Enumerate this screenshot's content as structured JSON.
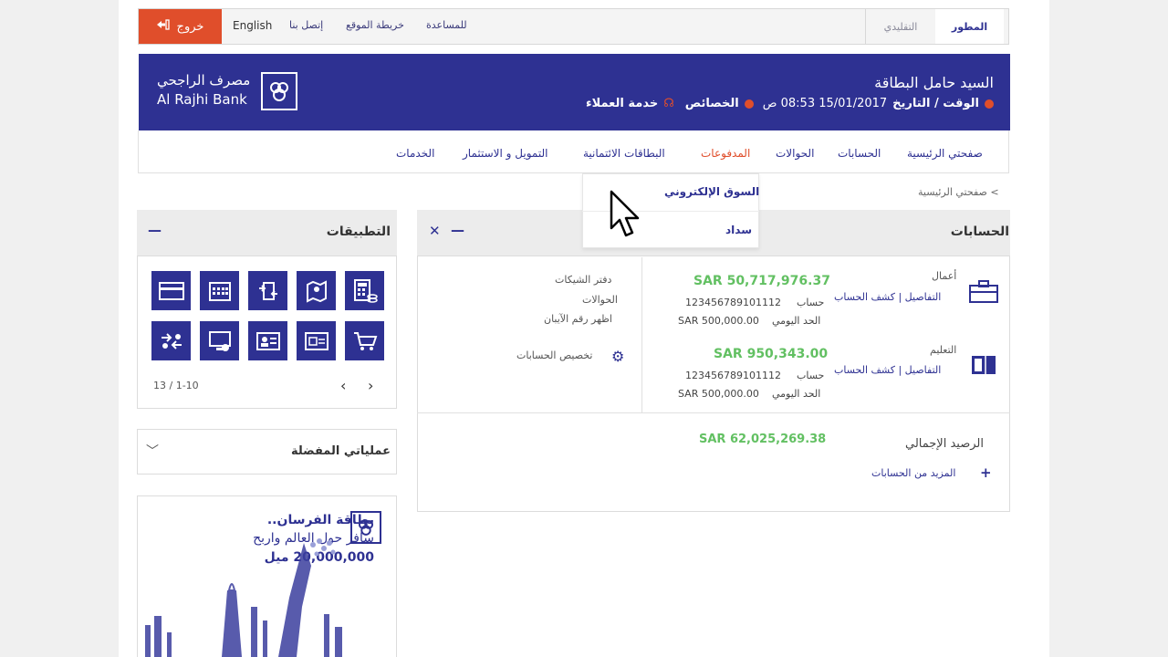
{
  "topbar": {
    "logout_label": "خروج",
    "links": [
      "English",
      "إتصل بنا",
      "خريطة الموقع",
      "للمساعدة"
    ],
    "view_tabs": {
      "classic": "التقليدي",
      "advanced": "المطور"
    }
  },
  "header": {
    "greeting": "السيد حامل البطاقة",
    "datetime_label": "الوقت / التاريخ",
    "datetime_value": "15/01/2017 08:53 ص",
    "features_label": "الخصائص",
    "customer_service_label": "خدمة العملاء",
    "logo_arabic": "مصرف الراجحي",
    "logo_english": "Al Rajhi Bank"
  },
  "nav": {
    "items": [
      "صفحتي الرئيسية",
      "الحسابات",
      "الحوالات",
      "المدفوعات",
      "البطاقات الائتمانية",
      "التمويل و الاستثمار",
      "الخدمات"
    ],
    "active_index": 3
  },
  "dropdown": {
    "items": [
      "السوق الإلكتروني",
      "سداد"
    ]
  },
  "breadcrumb": "> صفحتي الرئيسية",
  "accounts": {
    "title": "الحسابات",
    "rows": [
      {
        "type": "أعمال",
        "links": [
          "التفاصيل",
          "كشف الحساب"
        ],
        "balance": "SAR 50,717,976.37",
        "account_label": "حساب",
        "account_number": "123456789101112",
        "limit_label": "الحد اليومي",
        "limit_value": "SAR 500,000.00"
      },
      {
        "type": "التعليم",
        "links": [
          "التفاصيل",
          "كشف الحساب"
        ],
        "balance": "SAR 950,343.00",
        "account_label": "حساب",
        "account_number": "123456789101112",
        "limit_label": "الحد اليومي",
        "limit_value": "SAR 500,000.00"
      }
    ],
    "side_links": [
      "دفتر الشيكات",
      "الحوالات",
      "اظهر رقم الآيبان"
    ],
    "customize_label": "تخصيص الحسابات",
    "total_label": "الرصيد الإجمالي",
    "total_value": "SAR 62,025,269.38",
    "more_label": "المزيد من الحسابات"
  },
  "apps": {
    "title": "التطبيقات",
    "icons_row1": [
      "calculator-coins-icon",
      "map-pin-icon",
      "transfer-icon",
      "calendar-icon",
      "card-icon"
    ],
    "icons_row2": [
      "cart-icon",
      "id-card-icon",
      "person-card-icon",
      "computer-icon",
      "exchange-icon"
    ],
    "pager": "13 / 1-10"
  },
  "favorites": {
    "title": "عملياتي المفضلة"
  },
  "ad": {
    "line1": "بطاقة الفرسان..",
    "line2": "سافر حول العالم واربح",
    "line3": "20,000,000 ميل"
  },
  "colors": {
    "brand": "#2e3192",
    "accent": "#e04e2b",
    "balance": "#62c062"
  }
}
